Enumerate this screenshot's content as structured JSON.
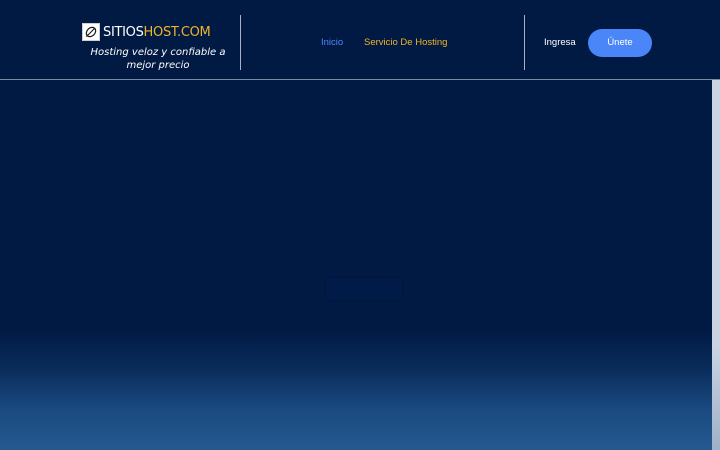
{
  "header": {
    "logo": {
      "text_main": "SITIOS",
      "text_accent": "HOST.COM",
      "icon": "leaf-icon"
    },
    "tagline": "Hosting veloz y confiable a mejor precio",
    "nav": {
      "inicio": "Inicio",
      "hosting": "Servicio De Hosting",
      "ingresa": "Ingresa",
      "join": "Únete"
    }
  },
  "colors": {
    "background": "#001a44",
    "accent_blue": "#4a86f7",
    "accent_gold": "#f0b429",
    "hero_gradient_bottom": "#24598f"
  }
}
